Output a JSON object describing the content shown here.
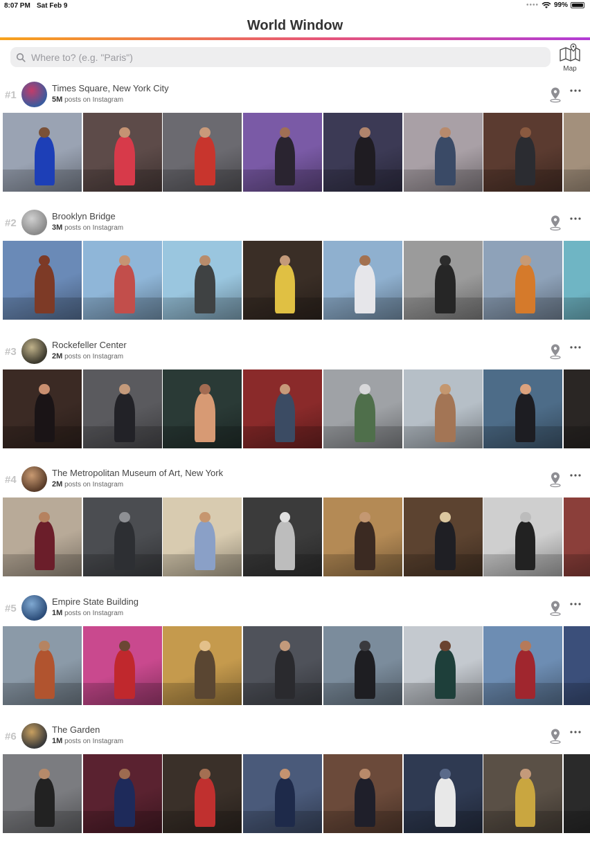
{
  "status_bar": {
    "time": "8:07 PM",
    "date": "Sat Feb 9",
    "dots": "••••",
    "battery": "99%",
    "battery_level": 0.99
  },
  "app": {
    "title": "World Window"
  },
  "search": {
    "placeholder": "Where to? (e.g. \"Paris\")",
    "value": ""
  },
  "map_button": {
    "label": "Map"
  },
  "locations": [
    {
      "rank": "#1",
      "name": "Times Square, New York City",
      "count": "5M",
      "posts_suffix": "posts on Instagram",
      "avatar_colors": [
        "#3b5b9e",
        "#c23c6a"
      ],
      "photos": [
        {
          "bg": "#9aa3b3",
          "fg": "#1d3fb7",
          "skin": "#7a5138"
        },
        {
          "bg": "#5d4b49",
          "fg": "#d73a4a",
          "skin": "#c59373"
        },
        {
          "bg": "#6b6a70",
          "fg": "#c8352d",
          "skin": "#c99a7a"
        },
        {
          "bg": "#7a5aa6",
          "fg": "#2a2430",
          "skin": "#a06f55"
        },
        {
          "bg": "#3c3a55",
          "fg": "#1f1c22",
          "skin": "#b0846c"
        },
        {
          "bg": "#a9a0a6",
          "fg": "#3a4a66",
          "skin": "#b88a6c"
        },
        {
          "bg": "#5b3b30",
          "fg": "#2b2c31",
          "skin": "#8a5a40"
        },
        {
          "bg": "#a3907c",
          "fg": "#5b4336",
          "skin": "#c89a78"
        }
      ]
    },
    {
      "rank": "#2",
      "name": "Brooklyn Bridge",
      "count": "3M",
      "posts_suffix": "posts on Instagram",
      "avatar_colors": [
        "#8a8a8a",
        "#d0d0d0"
      ],
      "photos": [
        {
          "bg": "#6a8ab7",
          "fg": "#7d3a26",
          "skin": "#7d3a26"
        },
        {
          "bg": "#8fb6d8",
          "fg": "#c24e4b",
          "skin": "#c69473"
        },
        {
          "bg": "#9ac6df",
          "fg": "#3f4243",
          "skin": "#b88c6c"
        },
        {
          "bg": "#3a2e26",
          "fg": "#e0c043",
          "skin": "#c49a7a"
        },
        {
          "bg": "#8fb0cf",
          "fg": "#e6e6ea",
          "skin": "#a37150"
        },
        {
          "bg": "#9b9b9b",
          "fg": "#262626",
          "skin": "#2c2c2c"
        },
        {
          "bg": "#8ea2b9",
          "fg": "#d57a2b",
          "skin": "#c69a76"
        },
        {
          "bg": "#6fb5c4",
          "fg": "#3b4f5c",
          "skin": "#9fb3c3"
        }
      ]
    },
    {
      "rank": "#3",
      "name": "Rockefeller Center",
      "count": "2M",
      "posts_suffix": "posts on Instagram",
      "avatar_colors": [
        "#3d3a2e",
        "#c0b28a"
      ],
      "photos": [
        {
          "bg": "#3b2a24",
          "fg": "#1a1416",
          "skin": "#c98f70"
        },
        {
          "bg": "#5a5a5e",
          "fg": "#222227",
          "skin": "#c49a7b"
        },
        {
          "bg": "#2a3a36",
          "fg": "#d79a74",
          "skin": "#a36c52"
        },
        {
          "bg": "#8a2a2a",
          "fg": "#3b4b63",
          "skin": "#c79a7a"
        },
        {
          "bg": "#9fa2a6",
          "fg": "#4f6f4b",
          "skin": "#d8d8da"
        },
        {
          "bg": "#b6bfc7",
          "fg": "#a37555",
          "skin": "#c4976f"
        },
        {
          "bg": "#4d6c88",
          "fg": "#1d1d22",
          "skin": "#dba27e"
        },
        {
          "bg": "#2a2624",
          "fg": "#1a1a1a",
          "skin": "#8a6350"
        }
      ]
    },
    {
      "rank": "#4",
      "name": "The Metropolitan Museum of Art, New York",
      "count": "2M",
      "posts_suffix": "posts on Instagram",
      "avatar_colors": [
        "#5a3d2a",
        "#c99a72"
      ],
      "photos": [
        {
          "bg": "#b8aa98",
          "fg": "#6b1e2a",
          "skin": "#b58260"
        },
        {
          "bg": "#4b4d51",
          "fg": "#2d2f33",
          "skin": "#8e9094"
        },
        {
          "bg": "#d8cbb0",
          "fg": "#8aa0c7",
          "skin": "#c6966f"
        },
        {
          "bg": "#3b3b3b",
          "fg": "#bdbdbd",
          "skin": "#e0e0e0"
        },
        {
          "bg": "#b48a55",
          "fg": "#3b2a22",
          "skin": "#c49872"
        },
        {
          "bg": "#5c4330",
          "fg": "#1f1f24",
          "skin": "#dcc8a0"
        },
        {
          "bg": "#cfcfcf",
          "fg": "#222222",
          "skin": "#bcbcbc"
        },
        {
          "bg": "#8b3f3a",
          "fg": "#6a6a6a",
          "skin": "#a08070"
        }
      ]
    },
    {
      "rank": "#5",
      "name": "Empire State Building",
      "count": "1M",
      "posts_suffix": "posts on Instagram",
      "avatar_colors": [
        "#2d4e7a",
        "#7fa8d1"
      ],
      "photos": [
        {
          "bg": "#8b9aa8",
          "fg": "#b1542f",
          "skin": "#b58462"
        },
        {
          "bg": "#c9498e",
          "fg": "#c0282d",
          "skin": "#6c4634"
        },
        {
          "bg": "#c59a4d",
          "fg": "#5a4632",
          "skin": "#e3c08a"
        },
        {
          "bg": "#4f525a",
          "fg": "#2a2a2e",
          "skin": "#c39a7b"
        },
        {
          "bg": "#7b8c9c",
          "fg": "#1e1e22",
          "skin": "#3a3a3e"
        },
        {
          "bg": "#c4c9cf",
          "fg": "#1e3f3a",
          "skin": "#6a4330"
        },
        {
          "bg": "#6d8db3",
          "fg": "#a0262e",
          "skin": "#b67a5a"
        },
        {
          "bg": "#3b4f7a",
          "fg": "#c9866a",
          "skin": "#e8a878"
        }
      ]
    },
    {
      "rank": "#6",
      "name": "The Garden",
      "count": "1M",
      "posts_suffix": "posts on Instagram",
      "avatar_colors": [
        "#3a3a3a",
        "#c8a060"
      ],
      "photos": [
        {
          "bg": "#7b7c80",
          "fg": "#222222",
          "skin": "#b58a6a"
        },
        {
          "bg": "#5a2230",
          "fg": "#1e2a5a",
          "skin": "#9d6b50"
        },
        {
          "bg": "#3a3029",
          "fg": "#c0302f",
          "skin": "#a46f52"
        },
        {
          "bg": "#4a5a7a",
          "fg": "#1e2a4a",
          "skin": "#c49370"
        },
        {
          "bg": "#6b4a3a",
          "fg": "#1f1f2a",
          "skin": "#b88a6a"
        },
        {
          "bg": "#2f3a52",
          "fg": "#e8e8e8",
          "skin": "#5a6a8a"
        },
        {
          "bg": "#5a5046",
          "fg": "#c9a640",
          "skin": "#c49a7a"
        },
        {
          "bg": "#2a2a2a",
          "fg": "#e0e0e0",
          "skin": "#3a3a3a"
        }
      ]
    }
  ]
}
